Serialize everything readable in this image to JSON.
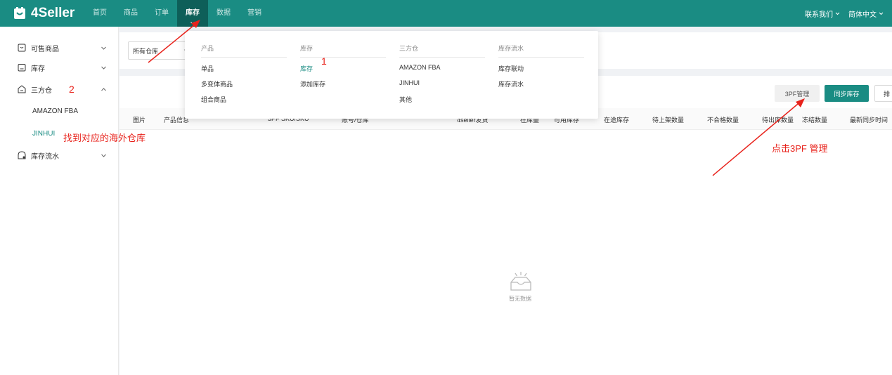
{
  "app": {
    "logo_text": "4Seller"
  },
  "nav": {
    "items": [
      "首页",
      "商品",
      "订单",
      "库存",
      "数据",
      "营销"
    ],
    "active": "库存"
  },
  "top_right": {
    "contact": "联系我们",
    "language": "简体中文"
  },
  "sidebar": {
    "sellable": "可售商品",
    "inventory": "库存",
    "third_party": "三方仓",
    "third_party_items": [
      "AMAZON FBA",
      "JINHUI"
    ],
    "active_sub": "JINHUI",
    "flow": "库存流水"
  },
  "filter": {
    "warehouse_select": "所有仓库"
  },
  "toolbar": {
    "btn_3pf": "3PF管理",
    "btn_sync": "同步库存",
    "btn_more": "排"
  },
  "table": {
    "columns": [
      "图片",
      "产品信息",
      "3PF SKU/SKU",
      "账号/仓库",
      "4seller发货",
      "在库量",
      "可用库存",
      "在途库存",
      "待上架数量",
      "不合格数量",
      "待出库数量",
      "冻结数量",
      "最新同步时间"
    ]
  },
  "empty": {
    "text": "暂无数据"
  },
  "dropdown": {
    "columns": [
      {
        "heading": "产品",
        "items": [
          "单品",
          "多变体商品",
          "组合商品"
        ]
      },
      {
        "heading": "库存",
        "items": [
          "库存",
          "添加库存"
        ]
      },
      {
        "heading": "三方仓",
        "items": [
          "AMAZON FBA",
          "JINHUI",
          "其他"
        ]
      },
      {
        "heading": "库存流水",
        "items": [
          "库存联动",
          "库存流水"
        ]
      }
    ],
    "active_item": "库存"
  },
  "annotations": {
    "step1": "1",
    "step2": "2",
    "find_warehouse": "找到对应的海外仓库",
    "click_3pf": "点击3PF 管理"
  },
  "colors": {
    "primary": "#1a8c83",
    "annotation": "#e8221b"
  }
}
